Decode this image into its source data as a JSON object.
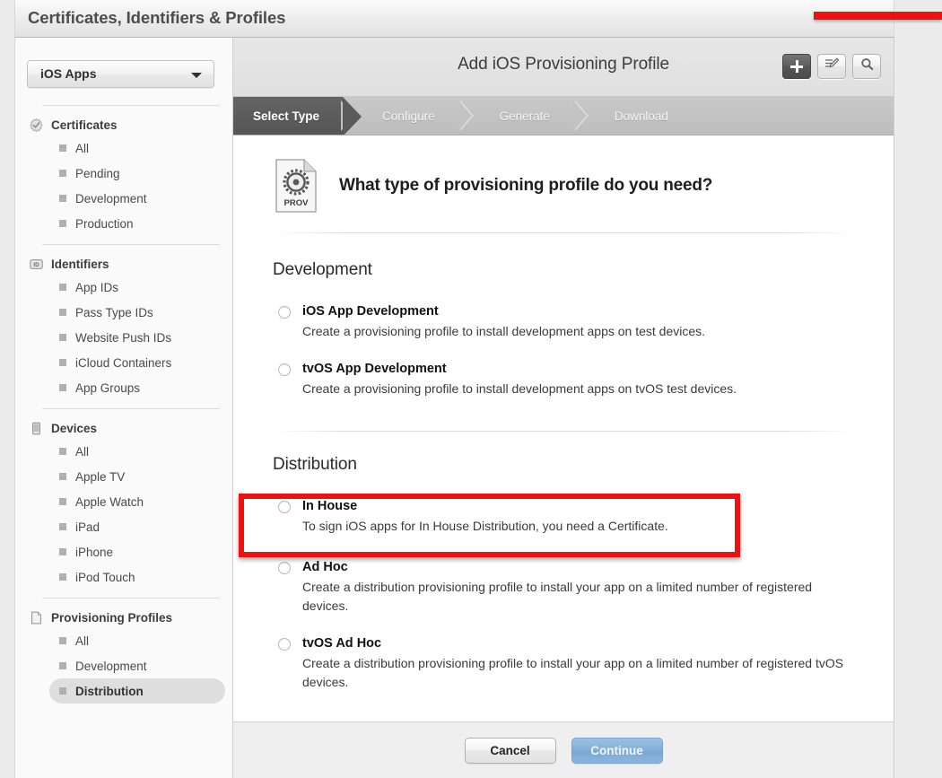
{
  "window": {
    "title": "Certificates, Identifiers & Profiles",
    "account_name": "",
    "redaction": {
      "color": "#ee1111",
      "note": "red-bar-over-account-name"
    }
  },
  "sidebar": {
    "team_select": {
      "value": "iOS Apps",
      "icon": "chevron-down-icon"
    },
    "groups": [
      {
        "label": "Certificates",
        "icon": "certificate-seal-icon",
        "items": [
          {
            "label": "All",
            "selected": false
          },
          {
            "label": "Pending",
            "selected": false
          },
          {
            "label": "Development",
            "selected": false
          },
          {
            "label": "Production",
            "selected": false
          }
        ]
      },
      {
        "label": "Identifiers",
        "icon": "id-badge-icon",
        "items": [
          {
            "label": "App IDs",
            "selected": false
          },
          {
            "label": "Pass Type IDs",
            "selected": false
          },
          {
            "label": "Website Push IDs",
            "selected": false
          },
          {
            "label": "iCloud Containers",
            "selected": false
          },
          {
            "label": "App Groups",
            "selected": false
          }
        ]
      },
      {
        "label": "Devices",
        "icon": "device-phone-icon",
        "items": [
          {
            "label": "All",
            "selected": false
          },
          {
            "label": "Apple TV",
            "selected": false
          },
          {
            "label": "Apple Watch",
            "selected": false
          },
          {
            "label": "iPad",
            "selected": false
          },
          {
            "label": "iPhone",
            "selected": false
          },
          {
            "label": "iPod Touch",
            "selected": false
          }
        ]
      },
      {
        "label": "Provisioning Profiles",
        "icon": "document-icon",
        "items": [
          {
            "label": "All",
            "selected": false
          },
          {
            "label": "Development",
            "selected": false
          },
          {
            "label": "Distribution",
            "selected": true
          }
        ]
      }
    ]
  },
  "main": {
    "title": "Add iOS Provisioning Profile",
    "toolbar": [
      {
        "name": "add-button",
        "icon": "plus-icon",
        "active": true
      },
      {
        "name": "edit-button",
        "icon": "pencil-edit-icon",
        "active": false
      },
      {
        "name": "search-button",
        "icon": "magnifier-icon",
        "active": false
      }
    ],
    "steps": [
      {
        "label": "Select Type",
        "state": "current"
      },
      {
        "label": "Configure",
        "state": "upcoming"
      },
      {
        "label": "Generate",
        "state": "upcoming"
      },
      {
        "label": "Download",
        "state": "upcoming"
      }
    ],
    "prompt": {
      "icon": "prov-profile-document-icon",
      "icon_label": "PROV",
      "title": "What type of provisioning profile do you need?"
    },
    "sections": [
      {
        "title": "Development",
        "options": [
          {
            "label": "iOS App Development",
            "description": "Create a provisioning profile to install development apps on test devices.",
            "selected": false,
            "highlighted": false
          },
          {
            "label": "tvOS App Development",
            "description": "Create a provisioning profile to install development apps on tvOS test devices.",
            "selected": false,
            "highlighted": false
          }
        ]
      },
      {
        "title": "Distribution",
        "options": [
          {
            "label": "In House",
            "description": "To sign iOS apps for In House Distribution, you need a Certificate.",
            "selected": false,
            "highlighted": true
          },
          {
            "label": "Ad Hoc",
            "description": "Create a distribution provisioning profile to install your app on a limited number of registered devices.",
            "selected": false,
            "highlighted": false
          },
          {
            "label": "tvOS Ad Hoc",
            "description": "Create a distribution provisioning profile to install your app on a limited number of registered tvOS devices.",
            "selected": false,
            "highlighted": false
          }
        ]
      }
    ],
    "footer": {
      "cancel_label": "Cancel",
      "continue_label": "Continue",
      "continue_enabled": false
    }
  },
  "colors": {
    "annotation_red": "#ee1111",
    "current_step_bg": "#555555",
    "selected_nav_bg": "#dedede",
    "continue_disabled": "#8ab5dc"
  }
}
